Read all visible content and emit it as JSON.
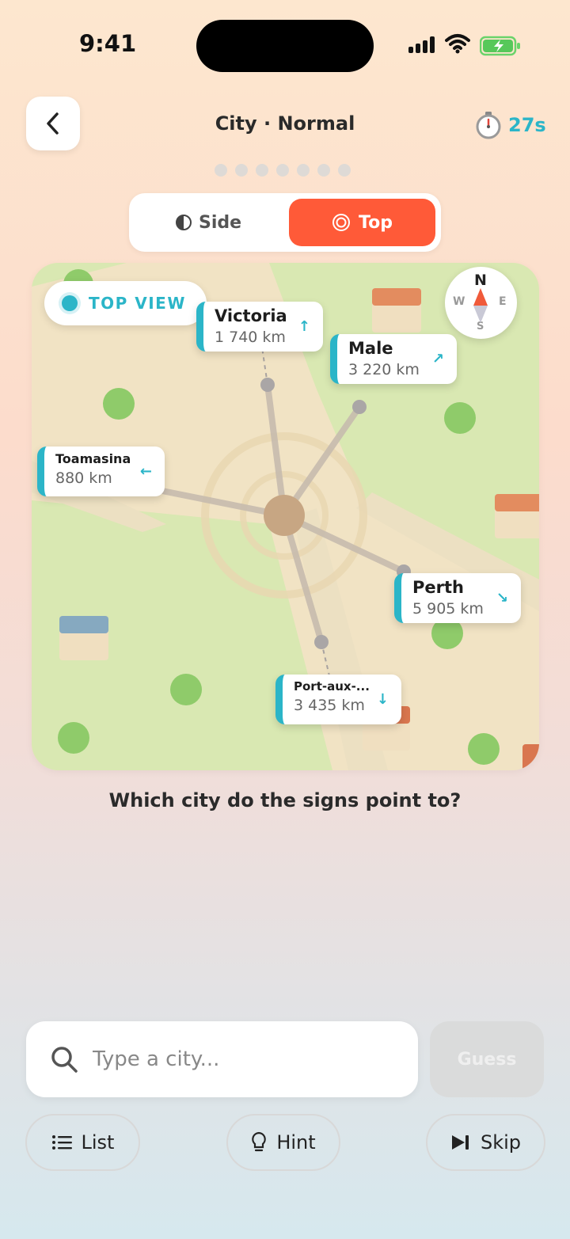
{
  "status": {
    "time": "9:41"
  },
  "header": {
    "title": "City · Normal",
    "timer": "27s",
    "progress_total": 7,
    "progress_done": 0
  },
  "view_toggle": {
    "side_label": "Side",
    "top_label": "Top",
    "selected": "Top"
  },
  "map": {
    "view_badge": "TOP VIEW",
    "compass": {
      "n": "N",
      "s": "S",
      "e": "E",
      "w": "W"
    },
    "signs": [
      {
        "name": "Victoria",
        "distance": "1 740 km",
        "arrow": "↑"
      },
      {
        "name": "Male",
        "distance": "3 220 km",
        "arrow": "↗"
      },
      {
        "name": "Toamasina",
        "distance": "880 km",
        "arrow": "←"
      },
      {
        "name": "Perth",
        "distance": "5 905 km",
        "arrow": "↘"
      },
      {
        "name": "Port-aux-...",
        "distance": "3 435 km",
        "arrow": "↓"
      }
    ]
  },
  "question": "Which city do the signs point to?",
  "input": {
    "placeholder": "Type a city...",
    "value": ""
  },
  "buttons": {
    "guess": "Guess",
    "list": "List",
    "hint": "Hint",
    "skip": "Skip"
  },
  "colors": {
    "accent": "#2bb5c8",
    "primary": "#ff5a38",
    "map_green": "#d7e8b4",
    "map_sand": "#f1e3c4"
  }
}
